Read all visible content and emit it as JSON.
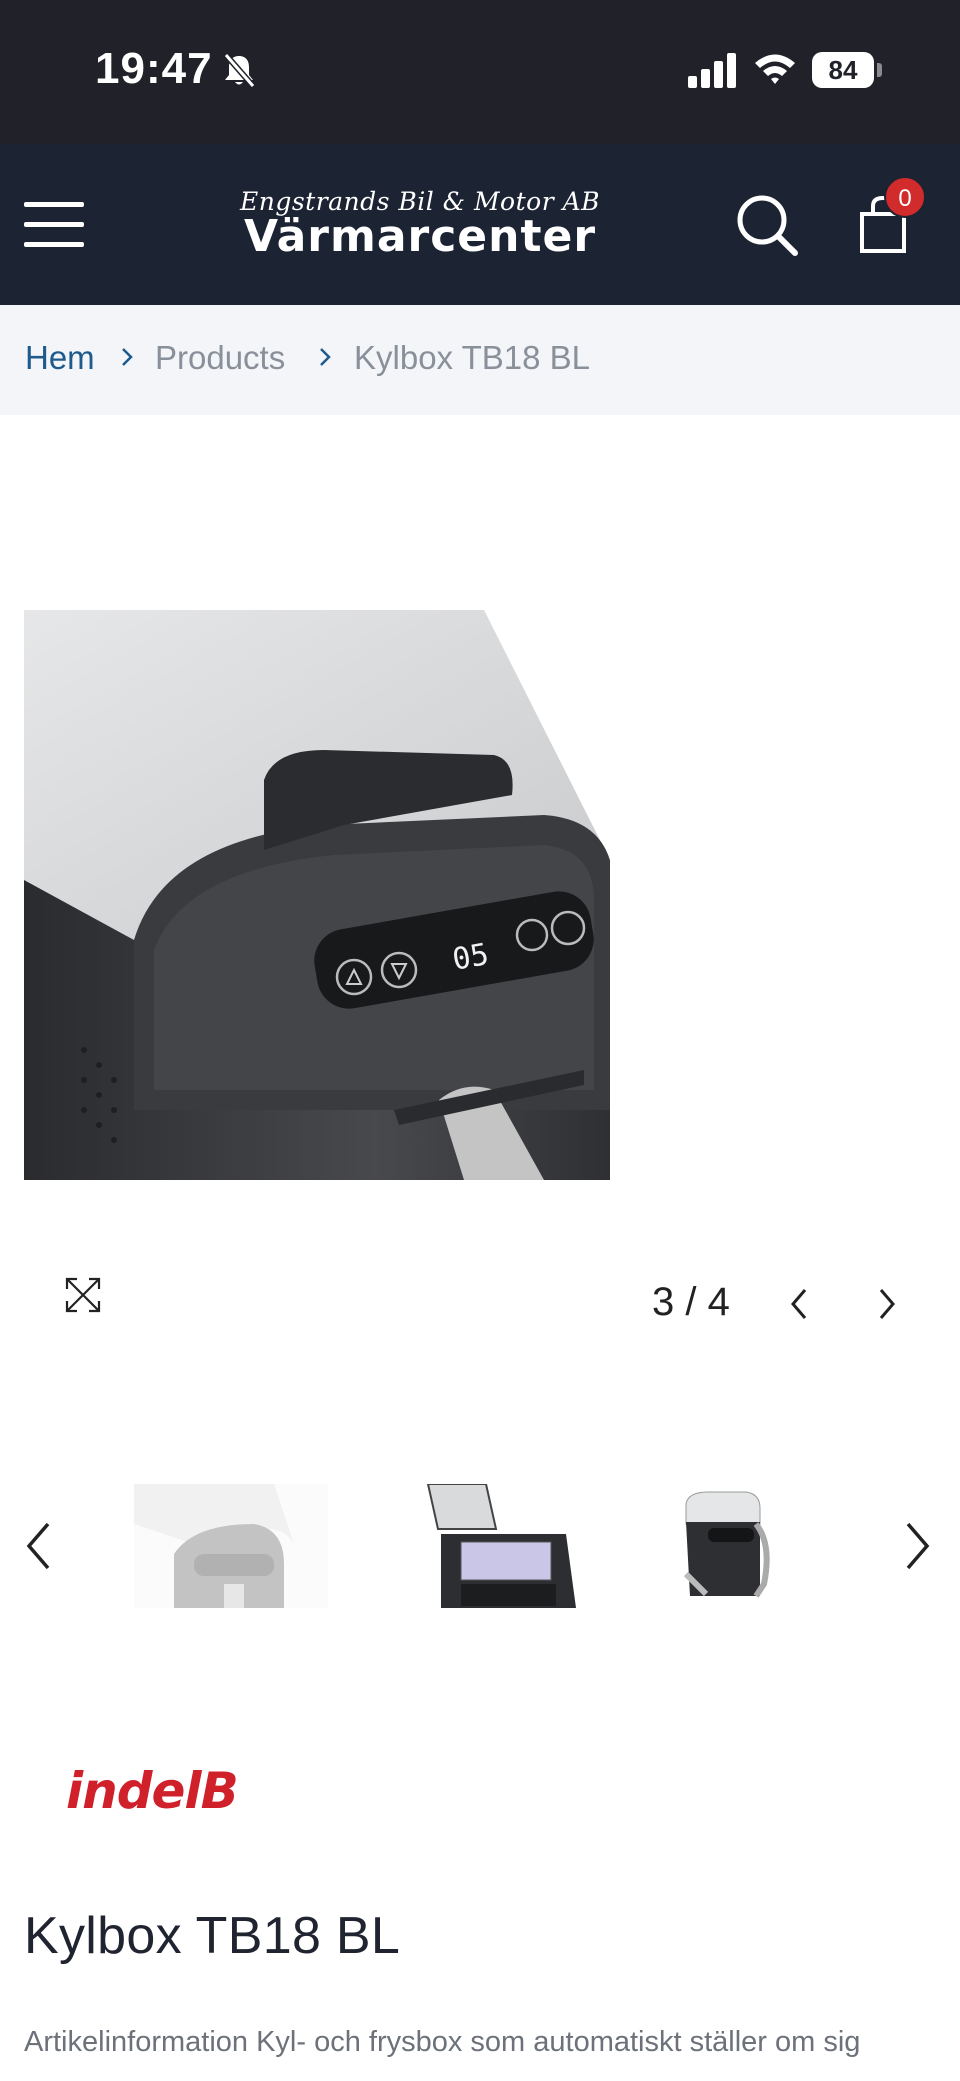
{
  "status_bar": {
    "time": "19:47",
    "battery": "84",
    "icons": [
      "bell-slash-icon",
      "cellular-signal-icon",
      "wifi-icon",
      "battery-icon"
    ]
  },
  "header": {
    "logo_tagline": "Engstrands Bil & Motor AB",
    "logo_name": "Värmarcenter",
    "cart_count": "0",
    "icons": [
      "menu-icon",
      "search-icon",
      "shopping-bag-icon"
    ]
  },
  "breadcrumb": {
    "items": [
      "Hem",
      "Products",
      "Kylbox TB18 BL"
    ]
  },
  "gallery": {
    "pager": "3 / 4",
    "display_digits": "05",
    "icons": [
      "expand-icon",
      "chevron-left-icon",
      "chevron-right-icon"
    ]
  },
  "product": {
    "brand": "indelB",
    "title": "Kylbox TB18 BL",
    "description": "Artikelinformation Kyl- och frysbox som automatiskt ställer om sig"
  },
  "colors": {
    "status_bar_bg": "#202129",
    "header_bg": "#1c2333",
    "breadcrumb_bg": "#f3f5f9",
    "link": "#1f5a8c",
    "badge": "#d22b2b",
    "brand_red": "#d0202a"
  }
}
